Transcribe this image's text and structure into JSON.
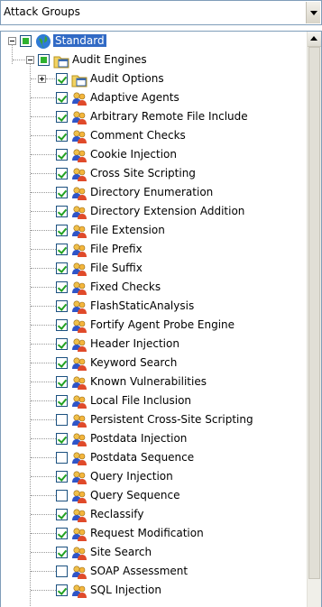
{
  "dropdown": {
    "value": "Attack Groups"
  },
  "root": {
    "label": "Standard",
    "check_state": "partial"
  },
  "group": {
    "label": "Audit Engines",
    "check_state": "partial"
  },
  "items": [
    {
      "label": "Audit Options",
      "checked": true,
      "icon": "folder-calendar-icon",
      "expander": "plus"
    },
    {
      "label": "Adaptive Agents",
      "checked": true,
      "icon": "agent-people-icon"
    },
    {
      "label": "Arbitrary Remote File Include",
      "checked": true,
      "icon": "agent-people-icon"
    },
    {
      "label": "Comment Checks",
      "checked": true,
      "icon": "agent-people-icon"
    },
    {
      "label": "Cookie Injection",
      "checked": true,
      "icon": "agent-people-icon"
    },
    {
      "label": "Cross Site Scripting",
      "checked": true,
      "icon": "agent-people-icon"
    },
    {
      "label": "Directory Enumeration",
      "checked": true,
      "icon": "agent-people-icon"
    },
    {
      "label": "Directory Extension Addition",
      "checked": true,
      "icon": "agent-people-icon"
    },
    {
      "label": "File Extension",
      "checked": true,
      "icon": "agent-people-icon"
    },
    {
      "label": "File Prefix",
      "checked": true,
      "icon": "agent-people-icon"
    },
    {
      "label": "File Suffix",
      "checked": true,
      "icon": "agent-people-icon"
    },
    {
      "label": "Fixed Checks",
      "checked": true,
      "icon": "agent-people-icon"
    },
    {
      "label": "FlashStaticAnalysis",
      "checked": true,
      "icon": "agent-people-icon"
    },
    {
      "label": "Fortify Agent Probe Engine",
      "checked": true,
      "icon": "agent-people-icon"
    },
    {
      "label": "Header Injection",
      "checked": true,
      "icon": "agent-people-icon"
    },
    {
      "label": "Keyword Search",
      "checked": true,
      "icon": "agent-people-icon"
    },
    {
      "label": "Known Vulnerabilities",
      "checked": true,
      "icon": "agent-people-icon"
    },
    {
      "label": "Local File Inclusion",
      "checked": true,
      "icon": "agent-people-icon"
    },
    {
      "label": "Persistent Cross-Site Scripting",
      "checked": false,
      "icon": "agent-people-icon"
    },
    {
      "label": "Postdata Injection",
      "checked": true,
      "icon": "agent-people-icon"
    },
    {
      "label": "Postdata Sequence",
      "checked": false,
      "icon": "agent-people-icon"
    },
    {
      "label": "Query Injection",
      "checked": true,
      "icon": "agent-people-icon"
    },
    {
      "label": "Query Sequence",
      "checked": false,
      "icon": "agent-people-icon"
    },
    {
      "label": "Reclassify",
      "checked": true,
      "icon": "agent-people-icon"
    },
    {
      "label": "Request Modification",
      "checked": true,
      "icon": "agent-people-icon"
    },
    {
      "label": "Site Search",
      "checked": true,
      "icon": "agent-people-icon"
    },
    {
      "label": "SOAP Assessment",
      "checked": false,
      "icon": "agent-people-icon"
    },
    {
      "label": "SQL Injection",
      "checked": true,
      "icon": "agent-people-icon"
    }
  ]
}
